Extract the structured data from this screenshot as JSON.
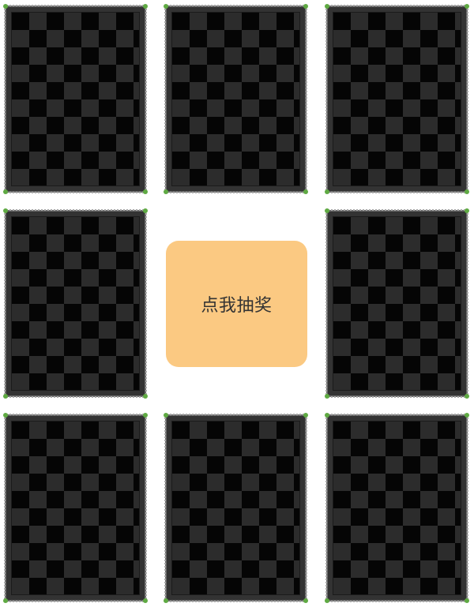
{
  "draw_button": {
    "label": "点我抽奖",
    "background_color": "#fbc982"
  },
  "cards": [
    {
      "label": "",
      "icon": "card-back-checkerboard"
    },
    {
      "label": "",
      "icon": "card-back-checkerboard"
    },
    {
      "label": "",
      "icon": "card-back-checkerboard"
    },
    {
      "label": "",
      "icon": "card-back-checkerboard"
    },
    {
      "label": "",
      "icon": "card-back-checkerboard"
    },
    {
      "label": "",
      "icon": "card-back-checkerboard"
    },
    {
      "label": "",
      "icon": "card-back-checkerboard"
    },
    {
      "label": "",
      "icon": "card-back-checkerboard"
    }
  ],
  "colors": {
    "card_dark": "#050505",
    "card_light": "#2c2c2c",
    "corner_dot": "#5faa43"
  }
}
